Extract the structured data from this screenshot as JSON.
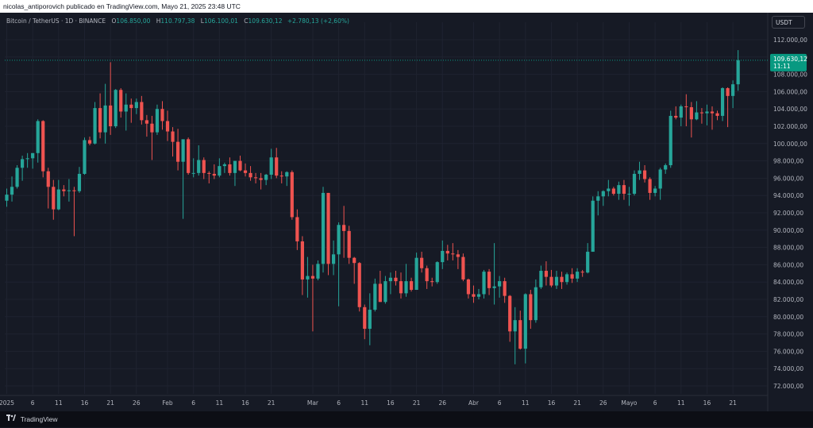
{
  "header": {
    "title": "nicolas_antiporovich publicado en TradingView.com, Mayo 21, 2025 23:48 UTC"
  },
  "legend": {
    "symbol": "Bitcoin / TetherUS · 1D · BINANCE",
    "o_label": "O",
    "o_value": "106.850,00",
    "h_label": "H",
    "h_value": "110.797,38",
    "l_label": "L",
    "l_value": "106.100,01",
    "c_label": "C",
    "c_value": "109.630,12",
    "change": "+2.780,13 (+2,60%)"
  },
  "currency_button": "USDT",
  "price_tag": {
    "price": "109.630,12",
    "countdown": "11:11"
  },
  "footer": {
    "brand": "TradingView"
  },
  "colors": {
    "up": "#26a69a",
    "down": "#ef5350",
    "background": "#161a25",
    "tag": "#089981"
  },
  "chart_data": {
    "type": "candlestick",
    "title": "",
    "ylim": [
      71000,
      113000
    ],
    "y_ticks": [
      {
        "value": 72000,
        "label": "72.000,00"
      },
      {
        "value": 74000,
        "label": "74.000,00"
      },
      {
        "value": 76000,
        "label": "76.000,00"
      },
      {
        "value": 78000,
        "label": "78.000,00"
      },
      {
        "value": 80000,
        "label": "80.000,00"
      },
      {
        "value": 82000,
        "label": "82.000,00"
      },
      {
        "value": 84000,
        "label": "84.000,00"
      },
      {
        "value": 86000,
        "label": "86.000,00"
      },
      {
        "value": 88000,
        "label": "88.000,00"
      },
      {
        "value": 90000,
        "label": "90.000,00"
      },
      {
        "value": 92000,
        "label": "92.000,00"
      },
      {
        "value": 94000,
        "label": "94.000,00"
      },
      {
        "value": 96000,
        "label": "96.000,00"
      },
      {
        "value": 98000,
        "label": "98.000,00"
      },
      {
        "value": 100000,
        "label": "100.000,00"
      },
      {
        "value": 102000,
        "label": "102.000,00"
      },
      {
        "value": 104000,
        "label": "104.000,00"
      },
      {
        "value": 106000,
        "label": "106.000,00"
      },
      {
        "value": 108000,
        "label": "108.000,00"
      },
      {
        "value": 110000,
        "label": "110.000,00"
      },
      {
        "value": 112000,
        "label": "112.000,00"
      }
    ],
    "x_ticks": [
      {
        "index": 0,
        "label": "2025"
      },
      {
        "index": 5,
        "label": "6"
      },
      {
        "index": 10,
        "label": "11"
      },
      {
        "index": 15,
        "label": "16"
      },
      {
        "index": 20,
        "label": "21"
      },
      {
        "index": 25,
        "label": "26"
      },
      {
        "index": 31,
        "label": "Feb"
      },
      {
        "index": 36,
        "label": "6"
      },
      {
        "index": 41,
        "label": "11"
      },
      {
        "index": 46,
        "label": "16"
      },
      {
        "index": 51,
        "label": "21"
      },
      {
        "index": 59,
        "label": "Mar"
      },
      {
        "index": 64,
        "label": "6"
      },
      {
        "index": 69,
        "label": "11"
      },
      {
        "index": 74,
        "label": "16"
      },
      {
        "index": 79,
        "label": "21"
      },
      {
        "index": 84,
        "label": "26"
      },
      {
        "index": 90,
        "label": "Abr"
      },
      {
        "index": 95,
        "label": "6"
      },
      {
        "index": 100,
        "label": "11"
      },
      {
        "index": 105,
        "label": "16"
      },
      {
        "index": 110,
        "label": "21"
      },
      {
        "index": 115,
        "label": "26"
      },
      {
        "index": 120,
        "label": "Mayo"
      },
      {
        "index": 125,
        "label": "6"
      },
      {
        "index": 130,
        "label": "11"
      },
      {
        "index": 135,
        "label": "16"
      },
      {
        "index": 140,
        "label": "21"
      }
    ],
    "last_price": 109630.12,
    "candles": [
      {
        "o": 93400,
        "h": 94800,
        "l": 92700,
        "c": 94100
      },
      {
        "o": 94100,
        "h": 96200,
        "l": 93300,
        "c": 95000
      },
      {
        "o": 95000,
        "h": 97500,
        "l": 94800,
        "c": 97200
      },
      {
        "o": 97200,
        "h": 98600,
        "l": 95700,
        "c": 98200
      },
      {
        "o": 98200,
        "h": 98900,
        "l": 97200,
        "c": 98300
      },
      {
        "o": 98300,
        "h": 98900,
        "l": 97100,
        "c": 98900
      },
      {
        "o": 98900,
        "h": 102800,
        "l": 97800,
        "c": 102600
      },
      {
        "o": 102600,
        "h": 102700,
        "l": 96100,
        "c": 96800
      },
      {
        "o": 96800,
        "h": 97200,
        "l": 92500,
        "c": 95000
      },
      {
        "o": 95000,
        "h": 95800,
        "l": 91200,
        "c": 92400
      },
      {
        "o": 92400,
        "h": 95800,
        "l": 92300,
        "c": 94700
      },
      {
        "o": 94700,
        "h": 95200,
        "l": 93900,
        "c": 94500
      },
      {
        "o": 94500,
        "h": 95900,
        "l": 93300,
        "c": 94600
      },
      {
        "o": 94600,
        "h": 95000,
        "l": 89300,
        "c": 94500
      },
      {
        "o": 94500,
        "h": 97300,
        "l": 94300,
        "c": 96500
      },
      {
        "o": 96500,
        "h": 100700,
        "l": 96400,
        "c": 100400
      },
      {
        "o": 100400,
        "h": 100800,
        "l": 99800,
        "c": 100000
      },
      {
        "o": 100000,
        "h": 104800,
        "l": 99900,
        "c": 104100
      },
      {
        "o": 104100,
        "h": 105800,
        "l": 100600,
        "c": 101300
      },
      {
        "o": 101300,
        "h": 106900,
        "l": 100000,
        "c": 104400
      },
      {
        "o": 104400,
        "h": 109400,
        "l": 101000,
        "c": 102000
      },
      {
        "o": 102000,
        "h": 106300,
        "l": 101800,
        "c": 106200
      },
      {
        "o": 106200,
        "h": 106400,
        "l": 103000,
        "c": 103700
      },
      {
        "o": 103700,
        "h": 105800,
        "l": 101500,
        "c": 104500
      },
      {
        "o": 104500,
        "h": 105200,
        "l": 102400,
        "c": 104100
      },
      {
        "o": 104100,
        "h": 105200,
        "l": 103400,
        "c": 104800
      },
      {
        "o": 104800,
        "h": 105500,
        "l": 102200,
        "c": 102700
      },
      {
        "o": 102700,
        "h": 103300,
        "l": 100800,
        "c": 102300
      },
      {
        "o": 102300,
        "h": 103200,
        "l": 98100,
        "c": 101300
      },
      {
        "o": 101300,
        "h": 104500,
        "l": 101000,
        "c": 104000
      },
      {
        "o": 104000,
        "h": 104900,
        "l": 101600,
        "c": 102600
      },
      {
        "o": 102600,
        "h": 103800,
        "l": 100300,
        "c": 101400
      },
      {
        "o": 101400,
        "h": 101900,
        "l": 98500,
        "c": 100200
      },
      {
        "o": 100200,
        "h": 101700,
        "l": 96900,
        "c": 97900
      },
      {
        "o": 97900,
        "h": 100100,
        "l": 91300,
        "c": 100500
      },
      {
        "o": 100500,
        "h": 100700,
        "l": 96400,
        "c": 96600
      },
      {
        "o": 96600,
        "h": 98300,
        "l": 96100,
        "c": 96600
      },
      {
        "o": 96600,
        "h": 99800,
        "l": 96300,
        "c": 98100
      },
      {
        "o": 98100,
        "h": 98400,
        "l": 95900,
        "c": 96600
      },
      {
        "o": 96600,
        "h": 96800,
        "l": 95400,
        "c": 96500
      },
      {
        "o": 96500,
        "h": 97600,
        "l": 95900,
        "c": 96300
      },
      {
        "o": 96300,
        "h": 98300,
        "l": 96100,
        "c": 97400
      },
      {
        "o": 97400,
        "h": 97800,
        "l": 96600,
        "c": 97600
      },
      {
        "o": 97600,
        "h": 98400,
        "l": 96300,
        "c": 96600
      },
      {
        "o": 96600,
        "h": 98000,
        "l": 95100,
        "c": 98000
      },
      {
        "o": 98000,
        "h": 98600,
        "l": 96800,
        "c": 96900
      },
      {
        "o": 96900,
        "h": 97700,
        "l": 96200,
        "c": 96600
      },
      {
        "o": 96600,
        "h": 97400,
        "l": 95700,
        "c": 96100
      },
      {
        "o": 96100,
        "h": 96600,
        "l": 95400,
        "c": 96000
      },
      {
        "o": 96000,
        "h": 96600,
        "l": 94700,
        "c": 95800
      },
      {
        "o": 95800,
        "h": 96500,
        "l": 95200,
        "c": 96400
      },
      {
        "o": 96400,
        "h": 99400,
        "l": 95900,
        "c": 98400
      },
      {
        "o": 98400,
        "h": 99500,
        "l": 96000,
        "c": 96300
      },
      {
        "o": 96300,
        "h": 96800,
        "l": 95400,
        "c": 96200
      },
      {
        "o": 96200,
        "h": 96800,
        "l": 95100,
        "c": 96700
      },
      {
        "o": 96700,
        "h": 96900,
        "l": 91200,
        "c": 91500
      },
      {
        "o": 91500,
        "h": 92400,
        "l": 87700,
        "c": 88700
      },
      {
        "o": 88700,
        "h": 89300,
        "l": 82500,
        "c": 84300
      },
      {
        "o": 84300,
        "h": 86900,
        "l": 82200,
        "c": 84700
      },
      {
        "o": 84700,
        "h": 86000,
        "l": 78300,
        "c": 84400
      },
      {
        "o": 84400,
        "h": 86500,
        "l": 84200,
        "c": 86100
      },
      {
        "o": 86100,
        "h": 95000,
        "l": 85100,
        "c": 94300
      },
      {
        "o": 94300,
        "h": 94300,
        "l": 84800,
        "c": 86100
      },
      {
        "o": 86100,
        "h": 88800,
        "l": 84800,
        "c": 87200
      },
      {
        "o": 87200,
        "h": 90900,
        "l": 81200,
        "c": 90600
      },
      {
        "o": 90600,
        "h": 92800,
        "l": 86800,
        "c": 89900
      },
      {
        "o": 89900,
        "h": 90500,
        "l": 86100,
        "c": 86800
      },
      {
        "o": 86800,
        "h": 86900,
        "l": 83800,
        "c": 86200
      },
      {
        "o": 86200,
        "h": 86300,
        "l": 80600,
        "c": 81100
      },
      {
        "o": 81100,
        "h": 81400,
        "l": 77400,
        "c": 78600
      },
      {
        "o": 78600,
        "h": 82700,
        "l": 76700,
        "c": 80800
      },
      {
        "o": 80800,
        "h": 84400,
        "l": 80600,
        "c": 83800
      },
      {
        "o": 83800,
        "h": 85300,
        "l": 81700,
        "c": 81700
      },
      {
        "o": 81700,
        "h": 84700,
        "l": 81500,
        "c": 84100
      },
      {
        "o": 84100,
        "h": 85100,
        "l": 82600,
        "c": 84500
      },
      {
        "o": 84500,
        "h": 85300,
        "l": 83600,
        "c": 84100
      },
      {
        "o": 84100,
        "h": 85100,
        "l": 82100,
        "c": 82700
      },
      {
        "o": 82700,
        "h": 86100,
        "l": 82300,
        "c": 84100
      },
      {
        "o": 84100,
        "h": 84500,
        "l": 82900,
        "c": 83100
      },
      {
        "o": 83100,
        "h": 87400,
        "l": 83100,
        "c": 86800
      },
      {
        "o": 86800,
        "h": 87500,
        "l": 85100,
        "c": 85600
      },
      {
        "o": 85600,
        "h": 85900,
        "l": 83200,
        "c": 84100
      },
      {
        "o": 84100,
        "h": 84500,
        "l": 83500,
        "c": 84000
      },
      {
        "o": 84000,
        "h": 86400,
        "l": 83800,
        "c": 86300
      },
      {
        "o": 86300,
        "h": 88800,
        "l": 85500,
        "c": 87600
      },
      {
        "o": 87600,
        "h": 88300,
        "l": 86500,
        "c": 87300
      },
      {
        "o": 87300,
        "h": 88500,
        "l": 86500,
        "c": 87200
      },
      {
        "o": 87200,
        "h": 87700,
        "l": 85500,
        "c": 86900
      },
      {
        "o": 86900,
        "h": 87300,
        "l": 84100,
        "c": 84300
      },
      {
        "o": 84300,
        "h": 84400,
        "l": 82100,
        "c": 82600
      },
      {
        "o": 82600,
        "h": 83600,
        "l": 81600,
        "c": 82300
      },
      {
        "o": 82300,
        "h": 83200,
        "l": 82000,
        "c": 82600
      },
      {
        "o": 82600,
        "h": 85400,
        "l": 82100,
        "c": 85200
      },
      {
        "o": 85200,
        "h": 85500,
        "l": 82500,
        "c": 83300
      },
      {
        "o": 83300,
        "h": 88500,
        "l": 81400,
        "c": 83500
      },
      {
        "o": 83500,
        "h": 84700,
        "l": 82200,
        "c": 84100
      },
      {
        "o": 84100,
        "h": 84500,
        "l": 81600,
        "c": 82400
      },
      {
        "o": 82400,
        "h": 82500,
        "l": 77100,
        "c": 78300
      },
      {
        "o": 78300,
        "h": 81100,
        "l": 74500,
        "c": 79600
      },
      {
        "o": 79600,
        "h": 80700,
        "l": 76200,
        "c": 76300
      },
      {
        "o": 76300,
        "h": 82700,
        "l": 74600,
        "c": 82600
      },
      {
        "o": 82600,
        "h": 83100,
        "l": 78600,
        "c": 79600
      },
      {
        "o": 79600,
        "h": 84300,
        "l": 79300,
        "c": 83400
      },
      {
        "o": 83400,
        "h": 85900,
        "l": 83200,
        "c": 85300
      },
      {
        "o": 85300,
        "h": 86400,
        "l": 83600,
        "c": 84600
      },
      {
        "o": 84600,
        "h": 85400,
        "l": 83400,
        "c": 83600
      },
      {
        "o": 83600,
        "h": 85300,
        "l": 83200,
        "c": 84600
      },
      {
        "o": 84600,
        "h": 85200,
        "l": 83200,
        "c": 84000
      },
      {
        "o": 84000,
        "h": 85100,
        "l": 83700,
        "c": 84900
      },
      {
        "o": 84900,
        "h": 85600,
        "l": 83900,
        "c": 84400
      },
      {
        "o": 84400,
        "h": 85600,
        "l": 84000,
        "c": 85200
      },
      {
        "o": 85200,
        "h": 85400,
        "l": 84600,
        "c": 85100
      },
      {
        "o": 85100,
        "h": 88500,
        "l": 85000,
        "c": 87500
      },
      {
        "o": 87500,
        "h": 93900,
        "l": 87500,
        "c": 93400
      },
      {
        "o": 93400,
        "h": 94500,
        "l": 91700,
        "c": 93900
      },
      {
        "o": 93900,
        "h": 94600,
        "l": 92800,
        "c": 94500
      },
      {
        "o": 94500,
        "h": 95800,
        "l": 93900,
        "c": 94800
      },
      {
        "o": 94800,
        "h": 95000,
        "l": 94000,
        "c": 94200
      },
      {
        "o": 94200,
        "h": 95600,
        "l": 93500,
        "c": 95200
      },
      {
        "o": 95200,
        "h": 95800,
        "l": 93500,
        "c": 94200
      },
      {
        "o": 94200,
        "h": 95000,
        "l": 92800,
        "c": 94200
      },
      {
        "o": 94200,
        "h": 96900,
        "l": 94000,
        "c": 96500
      },
      {
        "o": 96500,
        "h": 97900,
        "l": 95800,
        "c": 96900
      },
      {
        "o": 96900,
        "h": 97500,
        "l": 95500,
        "c": 95900
      },
      {
        "o": 95900,
        "h": 96100,
        "l": 93500,
        "c": 94300
      },
      {
        "o": 94300,
        "h": 95100,
        "l": 93900,
        "c": 94800
      },
      {
        "o": 94800,
        "h": 97200,
        "l": 93500,
        "c": 97000
      },
      {
        "o": 97000,
        "h": 97700,
        "l": 96500,
        "c": 97500
      },
      {
        "o": 97500,
        "h": 103800,
        "l": 97200,
        "c": 103200
      },
      {
        "o": 103200,
        "h": 104300,
        "l": 102800,
        "c": 103000
      },
      {
        "o": 103000,
        "h": 104500,
        "l": 102000,
        "c": 104300
      },
      {
        "o": 104300,
        "h": 105700,
        "l": 102000,
        "c": 104200
      },
      {
        "o": 104200,
        "h": 104800,
        "l": 100700,
        "c": 102800
      },
      {
        "o": 102800,
        "h": 104900,
        "l": 102700,
        "c": 103600
      },
      {
        "o": 103600,
        "h": 104100,
        "l": 102300,
        "c": 103500
      },
      {
        "o": 103500,
        "h": 104500,
        "l": 102100,
        "c": 103700
      },
      {
        "o": 103700,
        "h": 104300,
        "l": 101600,
        "c": 103500
      },
      {
        "o": 103500,
        "h": 103800,
        "l": 102700,
        "c": 103200
      },
      {
        "o": 103200,
        "h": 106500,
        "l": 102600,
        "c": 106400
      },
      {
        "o": 106400,
        "h": 106500,
        "l": 101900,
        "c": 105500
      },
      {
        "o": 105500,
        "h": 107300,
        "l": 104100,
        "c": 106850
      },
      {
        "o": 106850,
        "h": 110797,
        "l": 106100,
        "c": 109630
      }
    ]
  }
}
